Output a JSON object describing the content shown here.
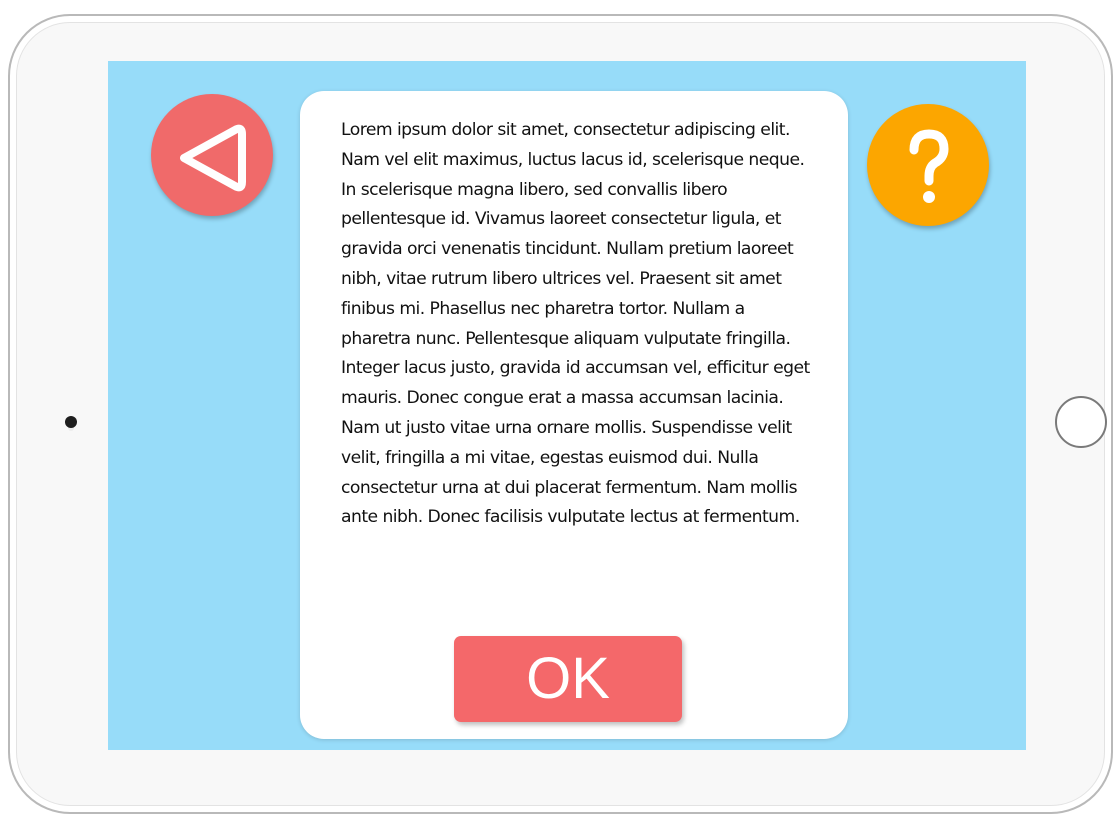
{
  "screen": {
    "background_color": "#97dcf9",
    "back_button": {
      "icon": "back-triangle-icon",
      "color": "#f06a6a"
    },
    "help_button": {
      "icon": "question-mark-icon",
      "color": "#fca600"
    },
    "dialog": {
      "body_text": "Lorem ipsum dolor sit amet, consectetur adipiscing elit. Nam vel elit maximus, luctus lacus id, scelerisque neque. In scelerisque magna libero, sed convallis libero pellentesque id. Vivamus laoreet consectetur ligula, et gravida orci venenatis tincidunt. Nullam pretium laoreet nibh, vitae rutrum libero ultrices vel. Praesent sit amet finibus mi. Phasellus nec pharetra tortor. Nullam a pharetra nunc. Pellentesque aliquam vulputate fringilla. Integer lacus justo, gravida id accumsan vel, efficitur eget mauris. Donec congue erat a massa accumsan lacinia. Nam ut justo vitae urna ornare mollis. Suspendisse velit velit, fringilla a mi vitae, egestas euismod dui. Nulla consectetur urna at dui placerat fermentum. Nam mollis ante nibh. Donec facilisis vulputate lectus at fermentum.",
      "ok_label": "OK",
      "ok_color": "#f4686a"
    }
  },
  "device": {
    "home_button_icon": "home-button-icon",
    "camera_icon": "camera-icon"
  }
}
